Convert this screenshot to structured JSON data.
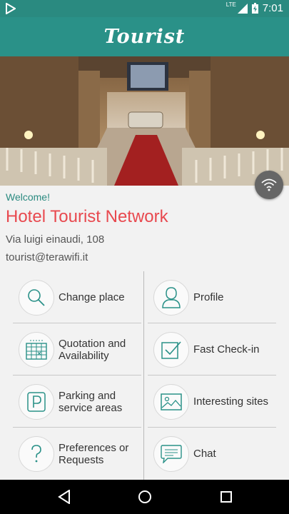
{
  "status_bar": {
    "network": "LTE",
    "time": "7:01"
  },
  "app_bar": {
    "title": "Tourist"
  },
  "info": {
    "welcome": "Welcome!",
    "hotel_name": "Hotel Tourist Network",
    "address": "Via luigi einaudi, 108",
    "email": "tourist@terawifi.it"
  },
  "menu": {
    "left": [
      {
        "label": "Change place",
        "icon": "search-icon"
      },
      {
        "label": "Quotation and Availability",
        "icon": "calendar-grid-icon"
      },
      {
        "label": "Parking and service areas",
        "icon": "parking-icon"
      },
      {
        "label": "Preferences or Requests",
        "icon": "question-icon"
      }
    ],
    "right": [
      {
        "label": "Profile",
        "icon": "person-icon"
      },
      {
        "label": "Fast Check-in",
        "icon": "checkbox-icon"
      },
      {
        "label": "Interesting sites",
        "icon": "image-icon"
      },
      {
        "label": "Chat",
        "icon": "chat-icon"
      }
    ]
  },
  "colors": {
    "primary": "#2a9188",
    "accent": "#e8494f"
  }
}
